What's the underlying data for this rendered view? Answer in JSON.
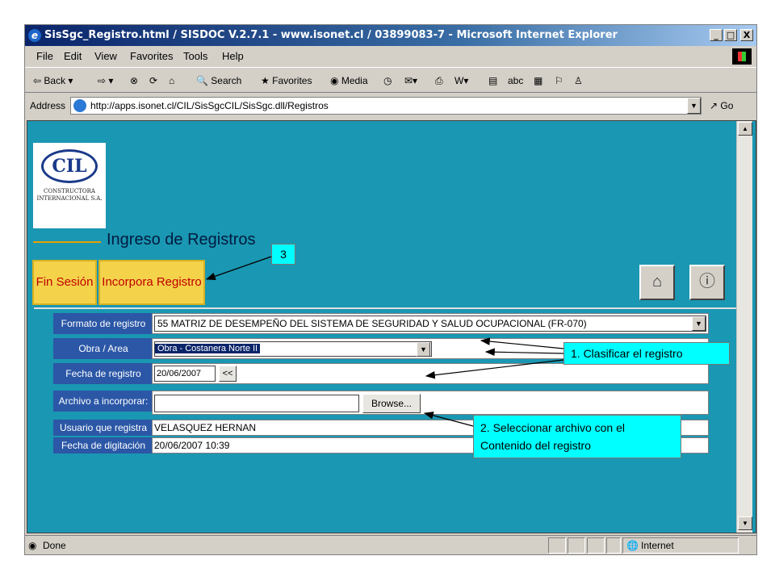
{
  "window": {
    "title": "SisSgc_Registro.html / SISDOC V.2.7.1 - www.isonet.cl / 03899083-7 - Microsoft Internet Explorer",
    "controls": [
      "_",
      "□",
      "X"
    ]
  },
  "menubar": {
    "items": [
      "File",
      "Edit",
      "View",
      "Favorites",
      "Tools",
      "Help"
    ]
  },
  "toolbar": {
    "back": "Back",
    "search": "Search",
    "favorites": "Favorites",
    "media": "Media"
  },
  "address": {
    "label": "Address",
    "url": "http://apps.isonet.cl/CIL/SisSgcCIL/SisSgc.dll/Registros",
    "go": "Go"
  },
  "logo": {
    "mark": "CIL",
    "text": "CONSTRUCTORA INTERNACIONAL S.A."
  },
  "page": {
    "heading": "Ingreso de Registros",
    "buttons": {
      "logout": "Fin Sesión",
      "add_record": "Incorpora Registro"
    }
  },
  "form": {
    "format_label": "Formato de registro",
    "format_value": "55 MATRIZ DE DESEMPEÑO DEL SISTEMA DE SEGURIDAD Y SALUD OCUPACIONAL (FR-070)",
    "area_label": "Obra / Area",
    "area_value": "Obra - Costanera Norte II",
    "date_label": "Fecha de registro",
    "date_value": "20/06/2007",
    "date_button": "<<",
    "file_label": "Archivo a incorporar:",
    "file_value": "",
    "browse": "Browse...",
    "user_label": "Usuario que registra",
    "user_value": "VELASQUEZ HERNAN",
    "digit_label": "Fecha de digitación",
    "digit_value": "20/06/2007 10:39"
  },
  "status": {
    "left": "Done",
    "zone": "Internet"
  },
  "annotations": {
    "step3": "3",
    "step1": "1. Clasificar el registro",
    "step2_line1": "2. Seleccionar archivo con el",
    "step2_line2": "Contenido del registro"
  },
  "colors": {
    "page_bg": "#1a97b2",
    "label_bg": "#2b57a6",
    "button_bg": "#f4d24a",
    "button_text": "#c00000",
    "callout_bg": "#00ffff"
  }
}
